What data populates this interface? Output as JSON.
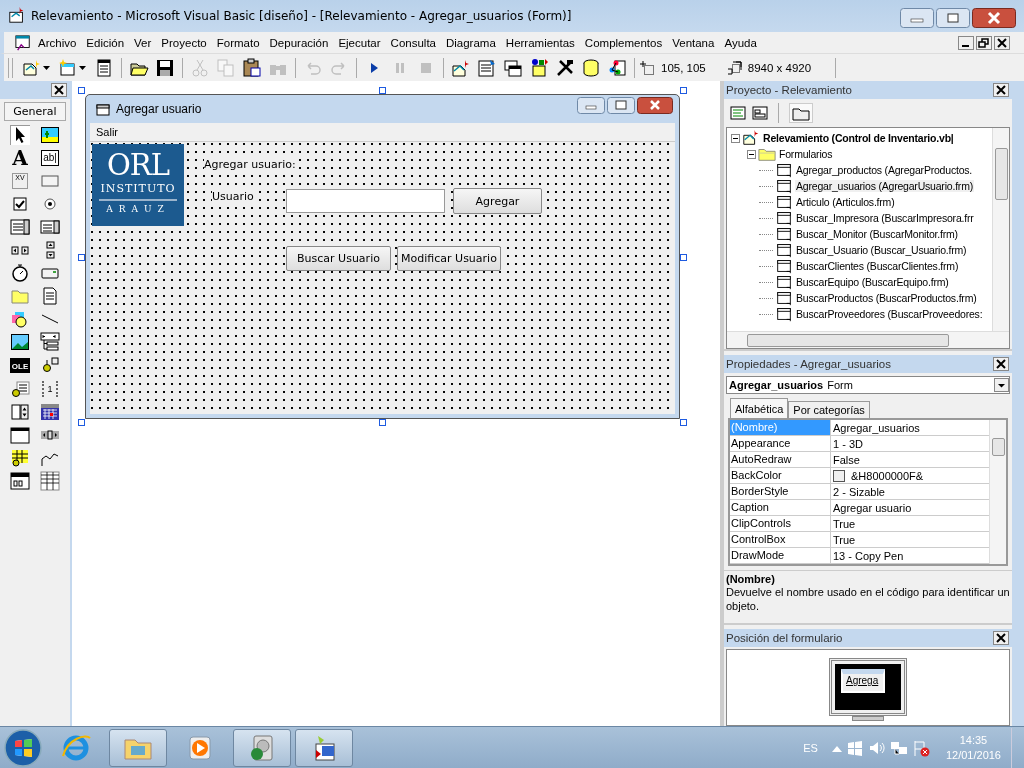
{
  "window": {
    "title": "Relevamiento - Microsoft Visual Basic [diseño] - [Relevamiento - Agregar_usuarios (Form)]"
  },
  "menu": [
    "Archivo",
    "Edición",
    "Ver",
    "Proyecto",
    "Formato",
    "Depuración",
    "Ejecutar",
    "Consulta",
    "Diagrama",
    "Herramientas",
    "Complementos",
    "Ventana",
    "Ayuda"
  ],
  "toolbar": {
    "buttons": [
      {
        "kind": "add-project",
        "dropdown": true,
        "disabled": false
      },
      {
        "kind": "add-form",
        "dropdown": true,
        "disabled": false
      },
      {
        "kind": "menu-editor",
        "dropdown": false,
        "disabled": false
      },
      {
        "kind": "open",
        "dropdown": false,
        "disabled": false
      },
      {
        "kind": "save",
        "dropdown": false,
        "disabled": false
      },
      {
        "kind": "cut",
        "dropdown": false,
        "disabled": true
      },
      {
        "kind": "copy",
        "dropdown": false,
        "disabled": true
      },
      {
        "kind": "paste",
        "dropdown": false,
        "disabled": false
      },
      {
        "kind": "find",
        "dropdown": false,
        "disabled": true
      },
      {
        "kind": "undo",
        "dropdown": false,
        "disabled": true
      },
      {
        "kind": "redo",
        "dropdown": false,
        "disabled": true
      },
      {
        "kind": "run",
        "dropdown": false,
        "disabled": false
      },
      {
        "kind": "pause",
        "dropdown": false,
        "disabled": true
      },
      {
        "kind": "stop",
        "dropdown": false,
        "disabled": true
      },
      {
        "kind": "project-explorer",
        "dropdown": false,
        "disabled": false
      },
      {
        "kind": "properties",
        "dropdown": false,
        "disabled": false
      },
      {
        "kind": "form-layout",
        "dropdown": false,
        "disabled": false
      },
      {
        "kind": "object-browser",
        "dropdown": false,
        "disabled": false
      },
      {
        "kind": "toolbox",
        "dropdown": false,
        "disabled": false
      },
      {
        "kind": "data-view",
        "dropdown": false,
        "disabled": false
      },
      {
        "kind": "components",
        "dropdown": false,
        "disabled": false
      }
    ],
    "position": "105, 105",
    "size": "8940 x 4920"
  },
  "toolbox": {
    "title": "General",
    "tools": [
      {
        "kind": "pointer",
        "selected": true
      },
      {
        "kind": "picture",
        "selected": false
      },
      {
        "kind": "glyph",
        "glyph": "A",
        "selected": false
      },
      {
        "kind": "glyph-box",
        "glyph": "ab|",
        "selected": false
      },
      {
        "kind": "frame",
        "glyph": "XV",
        "selected": false
      },
      {
        "kind": "button",
        "selected": false
      },
      {
        "kind": "checkbox",
        "selected": false
      },
      {
        "kind": "radio",
        "selected": false
      },
      {
        "kind": "combo",
        "selected": false
      },
      {
        "kind": "list",
        "selected": false
      },
      {
        "kind": "hscroll",
        "selected": false
      },
      {
        "kind": "vscroll",
        "selected": false
      },
      {
        "kind": "timer",
        "selected": false
      },
      {
        "kind": "drive",
        "selected": false
      },
      {
        "kind": "folder",
        "selected": false
      },
      {
        "kind": "file",
        "selected": false
      },
      {
        "kind": "shapes",
        "selected": false
      },
      {
        "kind": "line",
        "selected": false
      },
      {
        "kind": "image",
        "selected": false
      },
      {
        "kind": "data",
        "selected": false
      },
      {
        "kind": "ole",
        "glyph": "OLE",
        "selected": false
      },
      {
        "kind": "plug",
        "selected": false
      },
      {
        "kind": "plug-list",
        "selected": false
      },
      {
        "kind": "film",
        "glyph": "1",
        "selected": false
      },
      {
        "kind": "updown",
        "selected": false
      },
      {
        "kind": "calendar",
        "selected": false
      },
      {
        "kind": "window",
        "selected": false
      },
      {
        "kind": "slider",
        "selected": false
      },
      {
        "kind": "grid",
        "selected": false
      },
      {
        "kind": "chart",
        "selected": false
      },
      {
        "kind": "tabs",
        "selected": false
      },
      {
        "kind": "table",
        "selected": false
      }
    ]
  },
  "form": {
    "title": "Agregar usuario",
    "menu": [
      "Salir"
    ],
    "logo": {
      "main": "ORL",
      "line1": "INSTITUTO",
      "line2": "ARAUZ"
    },
    "controls": [
      {
        "kind": "label",
        "text": "Agregar usuario:"
      },
      {
        "kind": "label",
        "text": "Usuario"
      },
      {
        "kind": "textbox"
      },
      {
        "kind": "button",
        "text": "Agregar"
      },
      {
        "kind": "button",
        "text": "Buscar Usuario"
      },
      {
        "kind": "button",
        "text": "Modificar Usuario"
      }
    ]
  },
  "project": {
    "title": "Proyecto - Relevamiento",
    "tree": [
      {
        "label": "Relevamiento (Control de Inventario.vb|",
        "kind": "project",
        "expanded": true,
        "selected": false,
        "children": [
          {
            "label": "Formularios",
            "kind": "folder",
            "expanded": true,
            "selected": false,
            "children": [
              {
                "label": "Agregar_productos (AgregarProductos.",
                "kind": "form",
                "selected": false
              },
              {
                "label": "Agregar_usuarios (AgregarUsuario.frm)",
                "kind": "form",
                "selected": true
              },
              {
                "label": "Articulo (Articulos.frm)",
                "kind": "form",
                "selected": false
              },
              {
                "label": "Buscar_Impresora (BuscarImpresora.frr",
                "kind": "form",
                "selected": false
              },
              {
                "label": "Buscar_Monitor (BuscarMonitor.frm)",
                "kind": "form",
                "selected": false
              },
              {
                "label": "Buscar_Usuario (Buscar_Usuario.frm)",
                "kind": "form",
                "selected": false
              },
              {
                "label": "BuscarClientes (BuscarClientes.frm)",
                "kind": "form",
                "selected": false
              },
              {
                "label": "BuscarEquipo (BuscarEquipo.frm)",
                "kind": "form",
                "selected": false
              },
              {
                "label": "BuscarProductos (BuscarProductos.frm)",
                "kind": "form",
                "selected": false
              },
              {
                "label": "BuscarProveedores (BuscarProveedores:",
                "kind": "form",
                "selected": false
              }
            ]
          }
        ]
      }
    ]
  },
  "properties": {
    "title": "Propiedades - Agregar_usuarios",
    "object": {
      "name": "Agregar_usuarios",
      "type": "Form"
    },
    "tabs": [
      {
        "label": "Alfabética",
        "selected": true
      },
      {
        "label": "Por categorías",
        "selected": false
      }
    ],
    "rows": [
      {
        "name": "(Nombre)",
        "value": "Agregar_usuarios",
        "selected": true
      },
      {
        "name": "Appearance",
        "value": "1 - 3D",
        "selected": false
      },
      {
        "name": "AutoRedraw",
        "value": "False",
        "selected": false
      },
      {
        "name": "BackColor",
        "value": "&H8000000F&",
        "color": "#f0f0f0",
        "selected": false
      },
      {
        "name": "BorderStyle",
        "value": "2 - Sizable",
        "selected": false
      },
      {
        "name": "Caption",
        "value": "Agregar usuario",
        "selected": false
      },
      {
        "name": "ClipControls",
        "value": "True",
        "selected": false
      },
      {
        "name": "ControlBox",
        "value": "True",
        "selected": false
      },
      {
        "name": "DrawMode",
        "value": "13 - Copy Pen",
        "selected": false
      }
    ],
    "description": {
      "title": "(Nombre)",
      "text": "Devuelve el nombre usado en el código para identificar un objeto."
    }
  },
  "form_layout": {
    "title": "Posición del formulario",
    "preview_caption": "Agrega"
  },
  "taskbar": {
    "apps": [
      {
        "kind": "browser",
        "active": false
      },
      {
        "kind": "explorer",
        "active": true
      },
      {
        "kind": "media",
        "active": false
      },
      {
        "kind": "disk",
        "active": true
      },
      {
        "kind": "vb",
        "active": true
      }
    ],
    "language": "ES",
    "time": "14:35",
    "date": "12/01/2016"
  }
}
